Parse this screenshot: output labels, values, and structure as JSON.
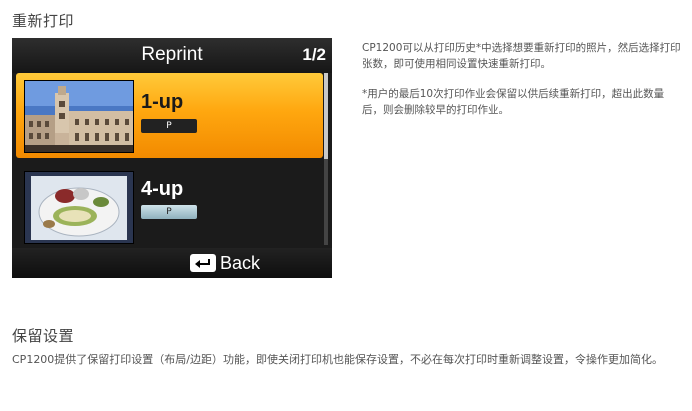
{
  "section1": {
    "title": "重新打印",
    "description": "CP1200可以从打印历史*中选择想要重新打印的照片，然后选择打印张数，即可使用相同设置快速重新打印。",
    "note": "*用户的最后10次打印作业会保留以供后续重新打印，超出此数量后，则会删除较早的打印作业。"
  },
  "screen": {
    "title": "Reprint",
    "page": "1/2",
    "items": [
      {
        "label": "1-up",
        "badge": "P",
        "selected": true
      },
      {
        "label": "4-up",
        "badge": "P",
        "selected": false
      }
    ],
    "back_label": "Back",
    "scroll_fraction": 0.5,
    "colors": {
      "highlight": "#ffa70f",
      "background": "#1b1b1b"
    }
  },
  "section2": {
    "title": "保留设置",
    "description": "CP1200提供了保留打印设置（布局/边距）功能，即使关闭打印机也能保存设置，不必在每次打印时重新调整设置，令操作更加简化。"
  }
}
